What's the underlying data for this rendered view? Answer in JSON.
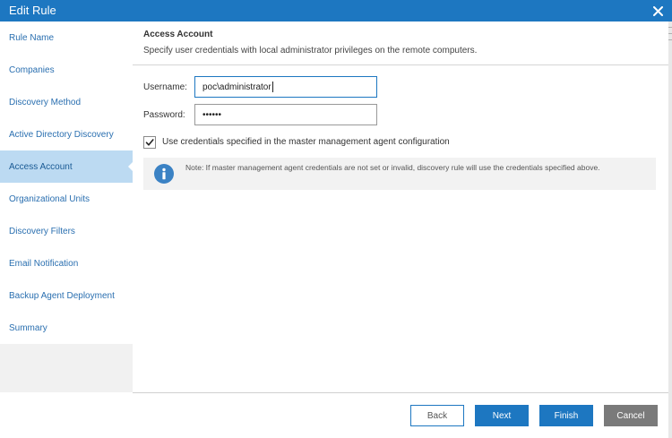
{
  "window": {
    "title": "Edit Rule"
  },
  "sidebar": {
    "items": [
      {
        "label": "Rule Name"
      },
      {
        "label": "Companies"
      },
      {
        "label": "Discovery Method"
      },
      {
        "label": "Active Directory Discovery"
      },
      {
        "label": "Access Account",
        "active": true
      },
      {
        "label": "Organizational Units"
      },
      {
        "label": "Discovery Filters"
      },
      {
        "label": "Email Notification"
      },
      {
        "label": "Backup Agent Deployment"
      },
      {
        "label": "Summary"
      }
    ]
  },
  "main": {
    "title": "Access Account",
    "description": "Specify user credentials with local administrator privileges on the remote computers.",
    "username": {
      "label": "Username:",
      "value": "poc\\administrator"
    },
    "password": {
      "label": "Password:",
      "value": "••••••"
    },
    "use_master_credentials": {
      "label": "Use credentials specified in the master management agent configuration",
      "checked": true
    },
    "note": "Note: If master management agent credentials are not set or invalid, discovery rule will use the credentials specified above."
  },
  "footer": {
    "back_label": "Back",
    "next_label": "Next",
    "finish_label": "Finish",
    "cancel_label": "Cancel"
  },
  "colors": {
    "accent": "#1d77c1",
    "active_item_bg": "#bcdaf2",
    "cancel_bg": "#7a7a7a"
  },
  "icons": {
    "close": "close-icon",
    "check": "checkmark-icon",
    "info": "info-icon"
  }
}
